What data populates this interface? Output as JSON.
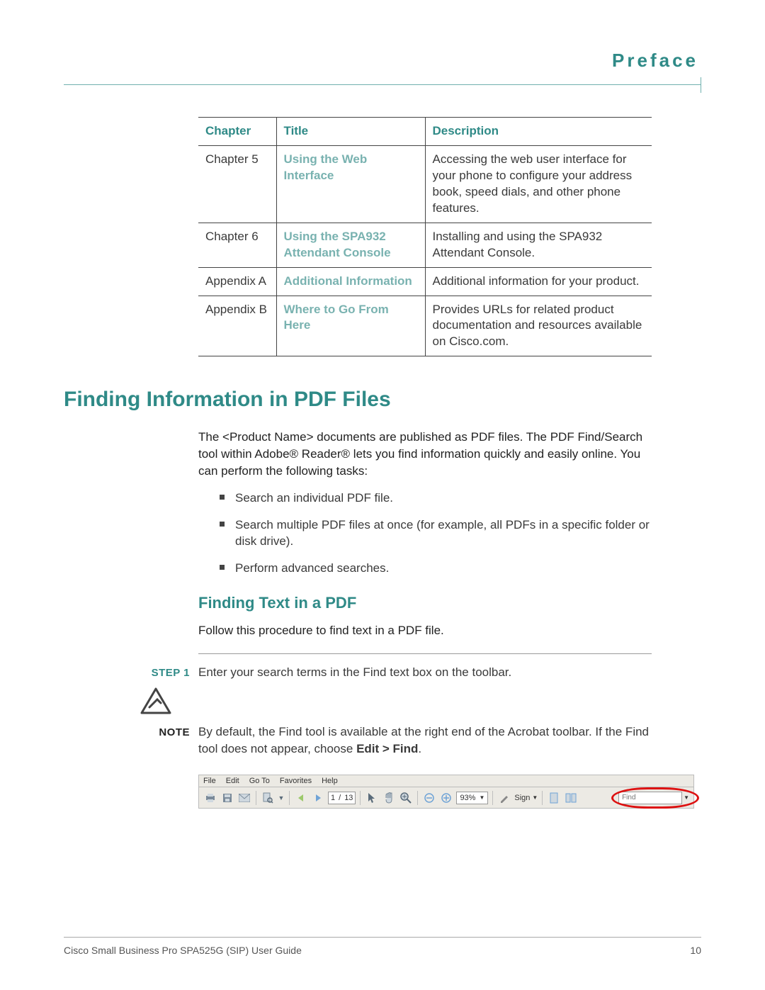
{
  "header": {
    "title": "Preface"
  },
  "table": {
    "headers": [
      "Chapter",
      "Title",
      "Description"
    ],
    "rows": [
      {
        "chapter": "Chapter 5",
        "title": "Using the Web Interface",
        "desc": "Accessing the web user interface for your phone to configure your address book, speed dials, and other phone features."
      },
      {
        "chapter": "Chapter 6",
        "title": "Using the SPA932 Attendant Console",
        "desc": "Installing and using the SPA932 Attendant Console."
      },
      {
        "chapter": "Appendix A",
        "title": "Additional Information",
        "desc": "Additional information for your product."
      },
      {
        "chapter": "Appendix B",
        "title": "Where to Go From Here",
        "desc": "Provides URLs for related product documentation and resources available on Cisco.com."
      }
    ]
  },
  "section": {
    "heading": "Finding Information in PDF Files",
    "para": "The <Product Name> documents are published as PDF files. The PDF Find/Search tool within Adobe® Reader® lets you find information quickly and easily online. You can perform the following tasks:",
    "bullets": [
      "Search an individual PDF file.",
      "Search multiple PDF files at once (for example, all PDFs in a specific folder or disk drive).",
      "Perform advanced searches."
    ]
  },
  "subsection": {
    "heading": "Finding Text in a PDF",
    "para": "Follow this procedure to find text in a PDF file.",
    "step_label": "STEP 1",
    "step_text": "Enter your search terms in the Find text box on the toolbar.",
    "note_label": "NOTE",
    "note_prefix": "By default, the Find tool is available at the right end of the Acrobat toolbar. If the Find tool does not appear, choose ",
    "note_bold": "Edit > Find",
    "note_suffix": "."
  },
  "toolbar": {
    "menus": [
      "File",
      "Edit",
      "Go To",
      "Favorites",
      "Help"
    ],
    "page_current": "1",
    "page_total": "13",
    "zoom": "93%",
    "sign": "Sign",
    "find_placeholder": "Find"
  },
  "footer": {
    "left": "Cisco Small Business Pro SPA525G (SIP) User Guide",
    "right": "10"
  }
}
